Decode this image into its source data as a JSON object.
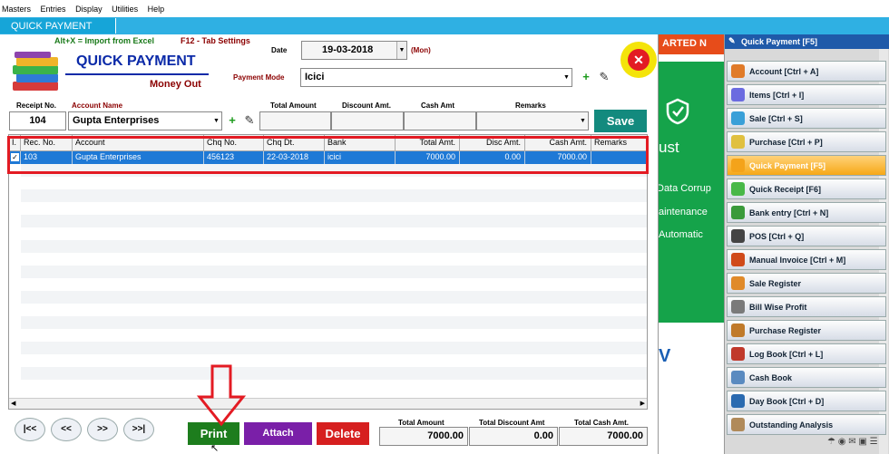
{
  "menubar": {
    "items": [
      "Masters",
      "Entries",
      "Display",
      "Utilities",
      "Help"
    ]
  },
  "tab": {
    "label": "QUICK PAYMENT"
  },
  "header": {
    "hint_import": "Alt+X = Import from Excel",
    "hint_tab": "F12 - Tab Settings",
    "title": "QUICK PAYMENT",
    "subtitle": "Money Out",
    "date_label": "Date",
    "date_value": "19-03-2018",
    "day": "(Mon)",
    "payment_mode_label": "Payment Mode",
    "payment_mode_value": "Icici"
  },
  "entry": {
    "receipt_label": "Receipt No.",
    "account_label": "Account Name",
    "total_label": "Total Amount",
    "discount_label": "Discount Amt.",
    "cash_label": "Cash Amt",
    "remarks_label": "Remarks",
    "receipt_value": "104",
    "account_value": "Gupta Enterprises",
    "save_label": "Save"
  },
  "grid": {
    "columns": [
      "I.",
      "Rec. No.",
      "Account",
      "Chq No.",
      "Chq Dt.",
      "Bank",
      "Total Amt.",
      "Disc Amt.",
      "Cash Amt.",
      "Remarks"
    ],
    "rows": [
      {
        "checked": true,
        "rec_no": "103",
        "account": "Gupta Enterprises",
        "chq_no": "456123",
        "chq_dt": "22-03-2018",
        "bank": "icici",
        "total": "7000.00",
        "disc": "0.00",
        "cash": "7000.00",
        "remarks": ""
      }
    ]
  },
  "footer": {
    "nav": [
      "|<<",
      "<<",
      ">>",
      ">>|"
    ],
    "print_label": "Print",
    "attach_label": "Attach",
    "delete_label": "Delete",
    "total_amount_label": "Total Amount",
    "total_amount_value": "7000.00",
    "total_discount_label": "Total Discount Amt",
    "total_discount_value": "0.00",
    "total_cash_label": "Total Cash Amt.",
    "total_cash_value": "7000.00"
  },
  "ad": {
    "banner": "ARTED N",
    "text1": "ust",
    "text2": "Data Corrup",
    "text3": "aintenance",
    "text4": "Automatic",
    "text5": "V"
  },
  "sidebar": {
    "header": "Quick Payment [F5]",
    "items": [
      {
        "label": "Account [Ctrl + A]",
        "icon": "account-icon",
        "color": "#e07b2a"
      },
      {
        "label": "Items [Ctrl + I]",
        "icon": "items-icon",
        "color": "#6b6be0"
      },
      {
        "label": "Sale [Ctrl + S]",
        "icon": "sale-icon",
        "color": "#3aa0d8"
      },
      {
        "label": "Purchase [Ctrl + P]",
        "icon": "purchase-icon",
        "color": "#e0c040"
      },
      {
        "label": "Quick Payment [F5]",
        "icon": "quick-payment-icon",
        "color": "#f4a31a",
        "active": true
      },
      {
        "label": "Quick Receipt [F6]",
        "icon": "quick-receipt-icon",
        "color": "#48b848"
      },
      {
        "label": "Bank entry [Ctrl + N]",
        "icon": "bank-entry-icon",
        "color": "#3a9a3a"
      },
      {
        "label": "POS [Ctrl + Q]",
        "icon": "pos-icon",
        "color": "#444"
      },
      {
        "label": "Manual Invoice [Ctrl + M]",
        "icon": "manual-invoice-icon",
        "color": "#d04a1a"
      },
      {
        "label": "Sale Register",
        "icon": "sale-register-icon",
        "color": "#e08a2a"
      },
      {
        "label": "Bill Wise Profit",
        "icon": "bill-wise-profit-icon",
        "color": "#7a7a7a"
      },
      {
        "label": "Purchase Register",
        "icon": "purchase-register-icon",
        "color": "#c07a2a"
      },
      {
        "label": "Log Book [Ctrl + L]",
        "icon": "log-book-icon",
        "color": "#c0392b"
      },
      {
        "label": "Cash Book",
        "icon": "cash-book-icon",
        "color": "#5a8ac0"
      },
      {
        "label": "Day Book [Ctrl + D]",
        "icon": "day-book-icon",
        "color": "#2a6ab0"
      },
      {
        "label": "Outstanding Analysis",
        "icon": "outstanding-analysis-icon",
        "color": "#b08a5a"
      }
    ]
  }
}
